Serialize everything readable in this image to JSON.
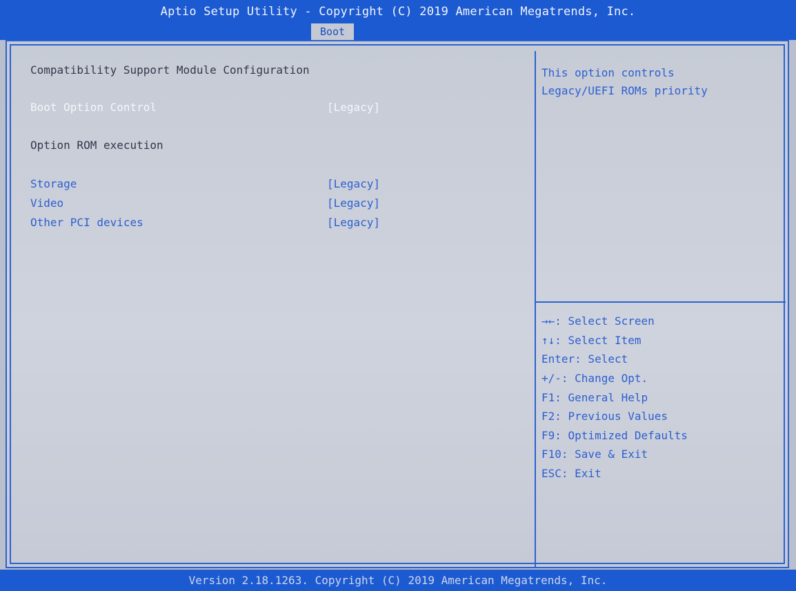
{
  "header": {
    "title": "Aptio Setup Utility - Copyright (C) 2019 American Megatrends, Inc.",
    "active_tab": "Boot"
  },
  "main": {
    "section_title": "Compatibility Support Module Configuration",
    "boot_option_control": {
      "label": "Boot Option Control",
      "value": "[Legacy]"
    },
    "option_rom_heading": "Option ROM execution",
    "storage": {
      "label": "Storage",
      "value": "[Legacy]"
    },
    "video": {
      "label": "Video",
      "value": "[Legacy]"
    },
    "other_pci": {
      "label": "Other PCI devices",
      "value": "[Legacy]"
    }
  },
  "help": {
    "line1": "This option controls",
    "line2": "Legacy/UEFI ROMs priority"
  },
  "keys": [
    "→←: Select Screen",
    "↑↓: Select Item",
    "Enter: Select",
    "+/-: Change Opt.",
    "F1: General Help",
    "F2: Previous Values",
    "F9: Optimized Defaults",
    "F10: Save & Exit",
    "ESC: Exit"
  ],
  "footer": {
    "text": "Version 2.18.1263. Copyright (C) 2019 American Megatrends, Inc."
  },
  "colors": {
    "bar_blue": "#1c5ad2",
    "panel_gray": "#c6cbd6",
    "text_blue": "#2d5fcf",
    "highlight_white": "#f4f6fb"
  }
}
